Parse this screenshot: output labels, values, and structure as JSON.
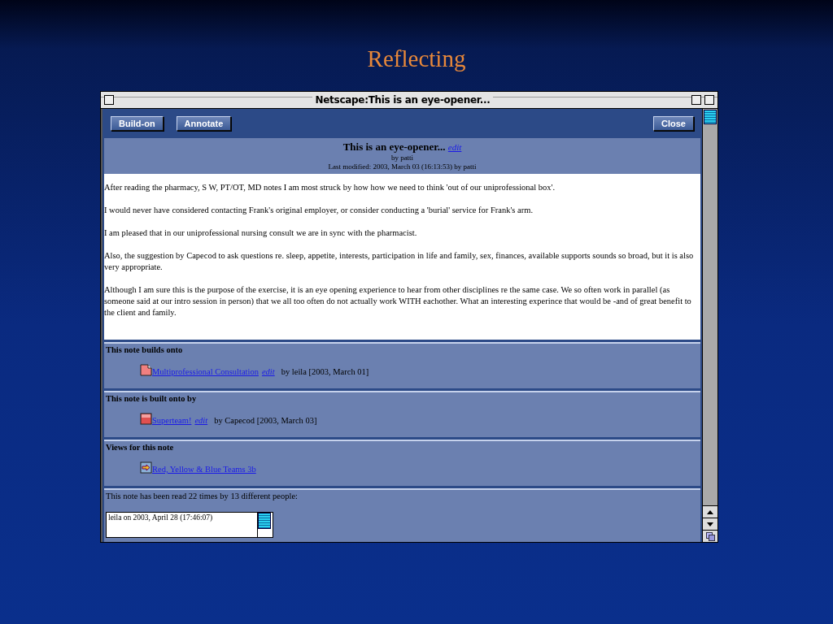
{
  "slide": {
    "title": "Reflecting"
  },
  "window": {
    "title": "Netscape:This is an eye-opener..."
  },
  "toolbar": {
    "buttons": [
      "Build-on",
      "Annotate"
    ],
    "close_button": "Close"
  },
  "note": {
    "title": "This is an eye-opener...",
    "edit_link": "edit",
    "author": "by patti",
    "modified": "Last modified: 2003, March 03 (16:13:53) by patti"
  },
  "paragraphs": [
    "After reading the pharmacy, S W, PT/OT, MD notes I am most struck by how how we need to think 'out of our uniprofessional box'.",
    "I would never have considered contacting Frank's original employer, or consider conducting a 'burial' service for Frank's arm.",
    "I am pleased that in our uniprofessional nursing consult we are in sync with the pharmacist.",
    "Also, the suggestion by Capecod to ask questions re. sleep, appetite, interests, participation in life and family, sex, finances, available supports sounds so broad, but it is also very appropriate.",
    "Although I am sure this is the purpose of the exercise, it is an eye opening experience to hear from other disciplines re the same case.  We so often work in parallel (as someone said at our intro session in person) that we all too often do not actually work WITH eachother.  What an interesting experince that would be -and of great benefit to the client and family."
  ],
  "sections": [
    {
      "heading": "This note builds onto",
      "items": [
        {
          "kind": "document",
          "link": "Multiprofessional Consultation",
          "edit_link": "edit",
          "byline": "by leila [2003, March 01]"
        }
      ]
    },
    {
      "heading": "This note is built onto by",
      "items": [
        {
          "kind": "note",
          "link": "Superteam!",
          "edit_link": "edit",
          "byline": "by Capecod [2003, March 03]"
        }
      ]
    },
    {
      "heading": "Views for this note",
      "items": [
        {
          "kind": "view",
          "link": "Red, Yellow & Blue Teams 3b"
        }
      ]
    }
  ],
  "reads": {
    "summary": "This note has been read 22 times by 13 different people:",
    "entries": [
      "leila on 2003, April 28 (17:46:07)"
    ]
  }
}
